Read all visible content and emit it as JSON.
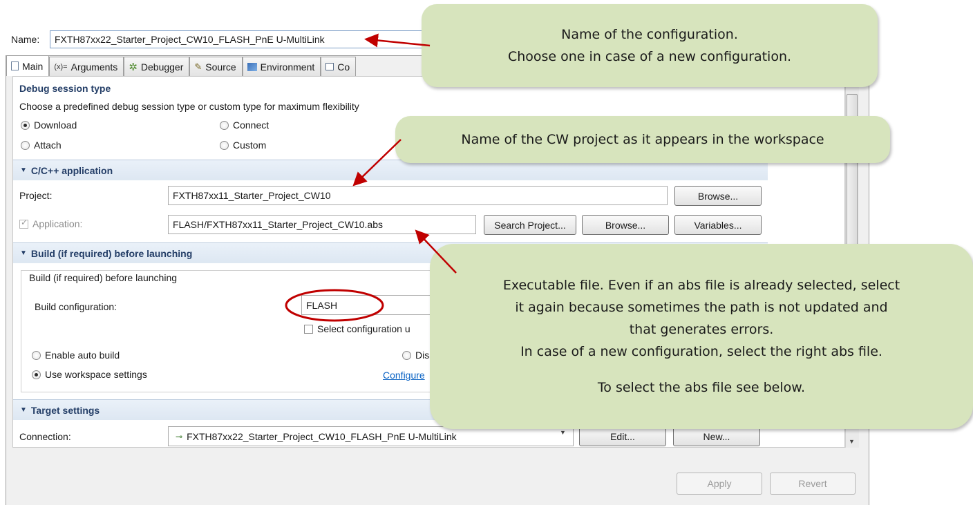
{
  "name_row": {
    "label": "Name:",
    "value": "FXTH87xx22_Starter_Project_CW10_FLASH_PnE U-MultiLink"
  },
  "tabs": [
    {
      "label": "Main",
      "icon": "page-icon"
    },
    {
      "label": "Arguments",
      "icon": "arguments-icon",
      "glyph": "(x)="
    },
    {
      "label": "Debugger",
      "icon": "debugger-bug-icon"
    },
    {
      "label": "Source",
      "icon": "source-icon"
    },
    {
      "label": "Environment",
      "icon": "environment-icon"
    },
    {
      "label": "Co",
      "icon": "common-icon"
    }
  ],
  "debug_session": {
    "title": "Debug session type",
    "description": "Choose a predefined debug session type or custom type for maximum flexibility",
    "options": [
      {
        "label": "Download",
        "selected": true
      },
      {
        "label": "Connect",
        "selected": false
      },
      {
        "label": "Attach",
        "selected": false
      },
      {
        "label": "Custom",
        "selected": false
      }
    ]
  },
  "cpp_app": {
    "title": "C/C++ application",
    "project_label": "Project:",
    "project_value": "FXTH87xx11_Starter_Project_CW10",
    "browse_label": "Browse...",
    "application_label": "Application:",
    "application_checked": true,
    "application_value": "FLASH/FXTH87xx11_Starter_Project_CW10.abs",
    "search_project_label": "Search Project...",
    "browse2_label": "Browse...",
    "variables_label": "Variables..."
  },
  "build": {
    "title": "Build (if required) before launching",
    "group_label": "Build (if required) before launching",
    "config_label": "Build configuration:",
    "config_value": "FLASH",
    "select_config_label": "Select configuration u",
    "enable_auto_label": "Enable auto build",
    "disable_auto_label": "Disabl",
    "use_workspace_label": "Use workspace settings",
    "configure_link": "Configure"
  },
  "target": {
    "title": "Target settings",
    "connection_label": "Connection:",
    "connection_value": "FXTH87xx22_Starter_Project_CW10_FLASH_PnE U-MultiLink",
    "edit_label": "Edit...",
    "new_label": "New..."
  },
  "footer": {
    "apply_label": "Apply",
    "revert_label": "Revert"
  },
  "callouts": {
    "c1_line1": "Name of the configuration.",
    "c1_line2": "Choose one in case of a new configuration.",
    "c2": "Name of the CW project as it appears in the workspace",
    "c3_line1": "Executable file. Even if an abs file is already selected, select",
    "c3_line2": "it again because sometimes the path is not updated and",
    "c3_line3": "that generates errors.",
    "c3_line4": "In case of a new configuration, select the right abs file.",
    "c3_line5": "To select the abs file see below."
  },
  "colors": {
    "callout_bg": "#d7e4bd",
    "arrow": "#c00000",
    "section_header_text": "#243e67",
    "highlight_ellipse": "#c00000"
  }
}
